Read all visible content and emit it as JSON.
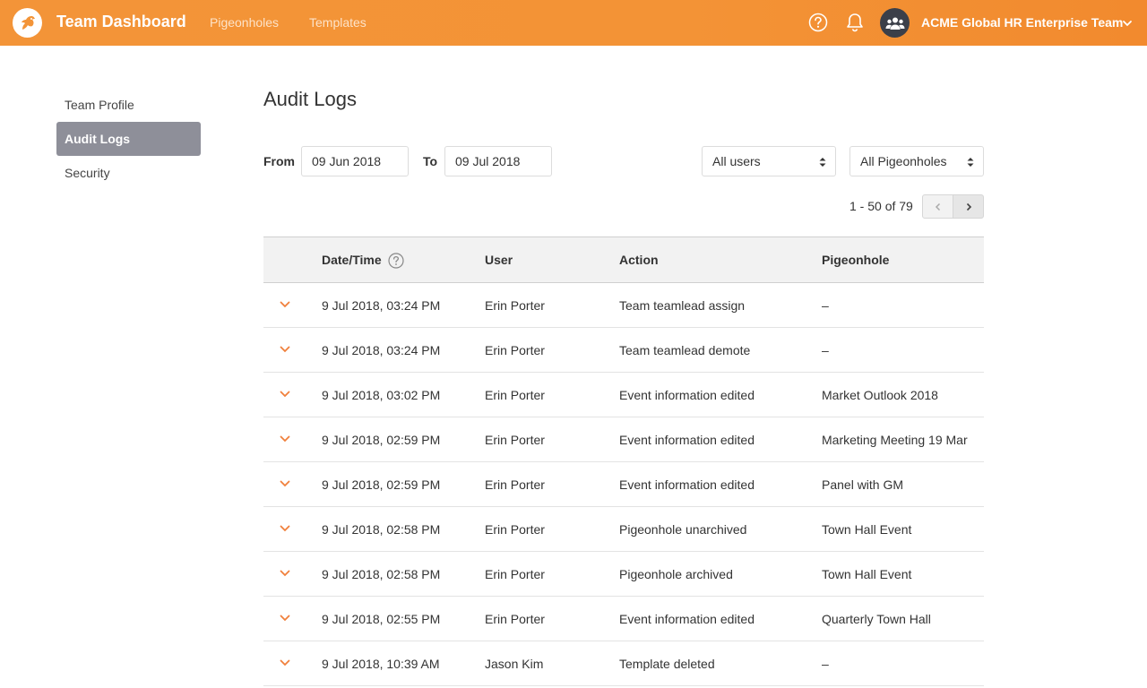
{
  "header": {
    "app_title": "Team Dashboard",
    "nav": [
      {
        "label": "Pigeonholes"
      },
      {
        "label": "Templates"
      }
    ],
    "team_name": "ACME Global HR Enterprise Team",
    "icons": {
      "logo": "pigeon-logo-icon",
      "help": "help-icon",
      "notifications": "bell-icon",
      "team": "team-users-icon",
      "dropdown": "chevron-down-icon"
    },
    "accent_color": "#f39438"
  },
  "sidebar": {
    "items": [
      {
        "label": "Team Profile",
        "active": false
      },
      {
        "label": "Audit Logs",
        "active": true
      },
      {
        "label": "Security",
        "active": false
      }
    ]
  },
  "main": {
    "title": "Audit Logs",
    "filters": {
      "from_label": "From",
      "from_value": "09 Jun 2018",
      "to_label": "To",
      "to_value": "09 Jul 2018",
      "user_select": "All users",
      "pigeonhole_select": "All Pigeonholes"
    },
    "pagination": {
      "text": "1 - 50 of 79"
    },
    "table": {
      "columns": [
        "Date/Time",
        "User",
        "Action",
        "Pigeonhole"
      ],
      "rows": [
        {
          "datetime": "9 Jul 2018, 03:24 PM",
          "user": "Erin Porter",
          "action": "Team teamlead assign",
          "pigeonhole": "–"
        },
        {
          "datetime": "9 Jul 2018, 03:24 PM",
          "user": "Erin Porter",
          "action": "Team teamlead demote",
          "pigeonhole": "–"
        },
        {
          "datetime": "9 Jul 2018, 03:02 PM",
          "user": "Erin Porter",
          "action": "Event information edited",
          "pigeonhole": "Market Outlook 2018"
        },
        {
          "datetime": "9 Jul 2018, 02:59 PM",
          "user": "Erin Porter",
          "action": "Event information edited",
          "pigeonhole": "Marketing Meeting 19 Mar"
        },
        {
          "datetime": "9 Jul 2018, 02:59 PM",
          "user": "Erin Porter",
          "action": "Event information edited",
          "pigeonhole": "Panel with GM"
        },
        {
          "datetime": "9 Jul 2018, 02:58 PM",
          "user": "Erin Porter",
          "action": "Pigeonhole unarchived",
          "pigeonhole": "Town Hall Event"
        },
        {
          "datetime": "9 Jul 2018, 02:58 PM",
          "user": "Erin Porter",
          "action": "Pigeonhole archived",
          "pigeonhole": "Town Hall Event"
        },
        {
          "datetime": "9 Jul 2018, 02:55 PM",
          "user": "Erin Porter",
          "action": "Event information edited",
          "pigeonhole": "Quarterly Town Hall"
        },
        {
          "datetime": "9 Jul 2018, 10:39 AM",
          "user": "Jason Kim",
          "action": "Template deleted",
          "pigeonhole": "–"
        }
      ]
    }
  }
}
